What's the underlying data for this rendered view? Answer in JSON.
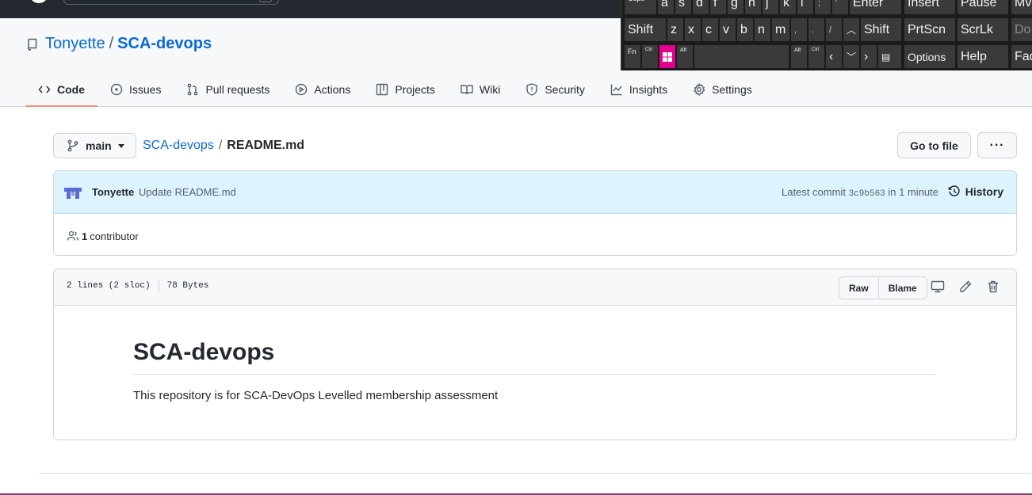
{
  "repo": {
    "owner": "Tonyette",
    "separator": "/",
    "name": "SCA-devops"
  },
  "tabs": [
    {
      "label": "Code",
      "icon": "code-icon"
    },
    {
      "label": "Issues",
      "icon": "issue-icon"
    },
    {
      "label": "Pull requests",
      "icon": "pull-request-icon"
    },
    {
      "label": "Actions",
      "icon": "play-icon"
    },
    {
      "label": "Projects",
      "icon": "table-icon"
    },
    {
      "label": "Wiki",
      "icon": "book-icon"
    },
    {
      "label": "Security",
      "icon": "shield-icon"
    },
    {
      "label": "Insights",
      "icon": "graph-icon"
    },
    {
      "label": "Settings",
      "icon": "gear-icon"
    }
  ],
  "file_nav": {
    "branch": "main",
    "repo_link": "SCA-devops",
    "sep": "/",
    "file": "README.md",
    "goto_file": "Go to file",
    "more": "···"
  },
  "commit": {
    "author": "Tonyette",
    "message": "Update README.md",
    "latest_prefix": "Latest commit",
    "sha": "3c9b563",
    "time": "in 1 minute",
    "history": "History"
  },
  "contributors": {
    "count": "1",
    "label": "contributor"
  },
  "file_info": {
    "lines": "2 lines (2 sloc)",
    "size": "78 Bytes",
    "raw": "Raw",
    "blame": "Blame"
  },
  "readme": {
    "heading": "SCA-devops",
    "body": "This repository is for SCA-DevOps Levelled membership assessment"
  },
  "keyboard": {
    "row1": [
      "Caps",
      "a",
      "s",
      "d",
      "f",
      "g",
      "h",
      "j",
      "k",
      "l",
      ";",
      "'",
      "Enter",
      "Insert",
      "Pause",
      "Mv"
    ],
    "row2": [
      "Shift",
      "z",
      "x",
      "c",
      "v",
      "b",
      "n",
      "m",
      ",",
      ".",
      "/",
      "Shift",
      "PrtScn",
      "ScrLk",
      "Do"
    ],
    "row3": [
      "Fn",
      "Ctrl",
      "Alt",
      "Alt",
      "Ctrl",
      "Options",
      "Help",
      "Fad"
    ],
    "accent": "#e3008c"
  }
}
